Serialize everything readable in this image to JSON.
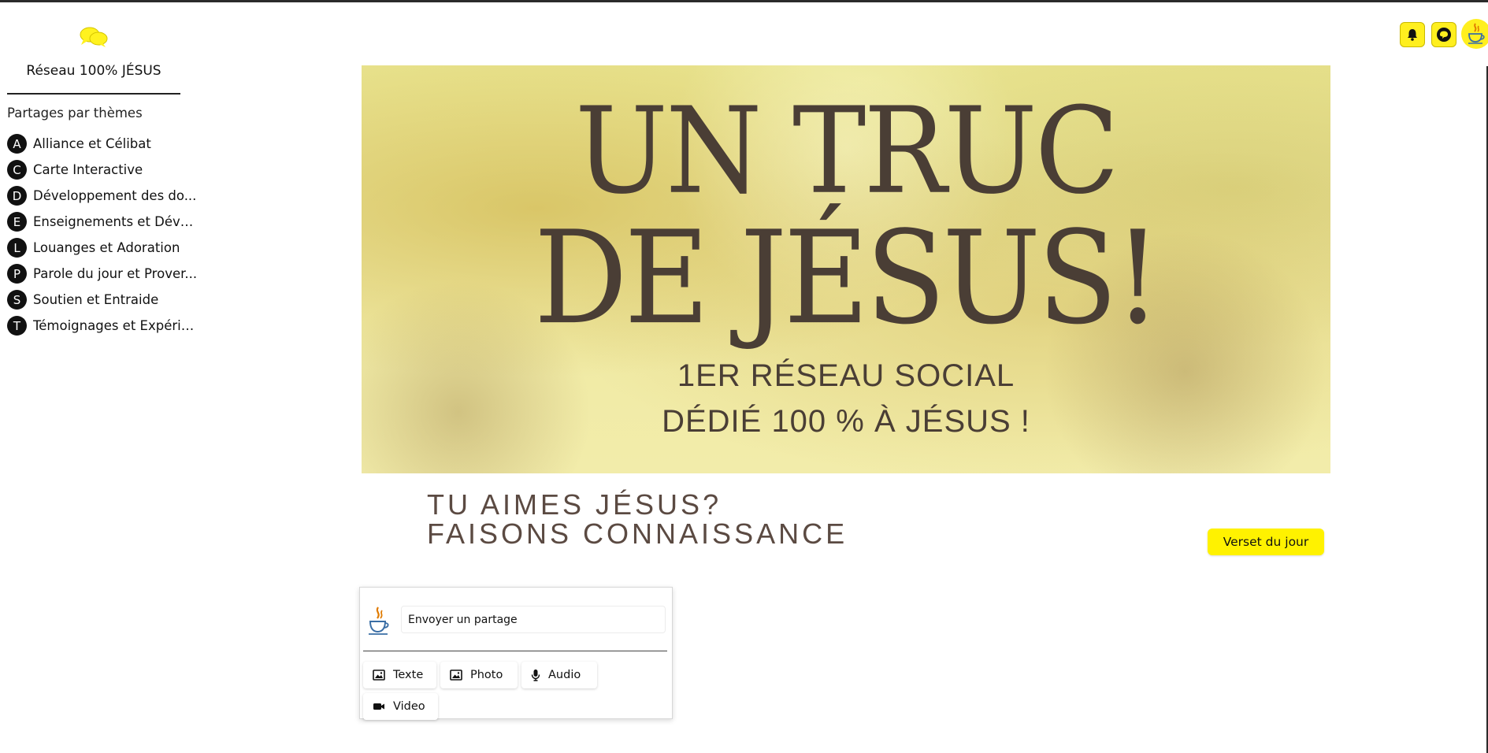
{
  "sidebar": {
    "brand": "Réseau 100% JÉSUS",
    "section_title": "Partages par thèmes",
    "themes": [
      {
        "letter": "A",
        "label": "Alliance et Célibat"
      },
      {
        "letter": "C",
        "label": "Carte Interactive"
      },
      {
        "letter": "D",
        "label": "Développement des do..."
      },
      {
        "letter": "E",
        "label": "Enseignements et Dévoi..."
      },
      {
        "letter": "L",
        "label": "Louanges et Adoration"
      },
      {
        "letter": "P",
        "label": "Parole du jour et Prover..."
      },
      {
        "letter": "S",
        "label": "Soutien et Entraide"
      },
      {
        "letter": "T",
        "label": "Témoignages et Expérie..."
      }
    ]
  },
  "header": {
    "icons": [
      "bell-icon",
      "chat-icon",
      "java-cup-icon"
    ],
    "accent": "#fff200"
  },
  "banner": {
    "line1": "UN TRUC",
    "line2": "DE JÉSUS!",
    "sub1": "1ER RÉSEAU SOCIAL",
    "sub2": "DÉDIÉ 100 % À JÉSUS !"
  },
  "tagline": {
    "line1": "TU AIMES JÉSUS?",
    "line2": "FAISONS CONNAISSANCE"
  },
  "verse_button": "Verset du jour",
  "composer": {
    "placeholder": "Envoyer un partage",
    "buttons": {
      "text": "Texte",
      "photo": "Photo",
      "audio": "Audio",
      "video": "Video"
    }
  }
}
